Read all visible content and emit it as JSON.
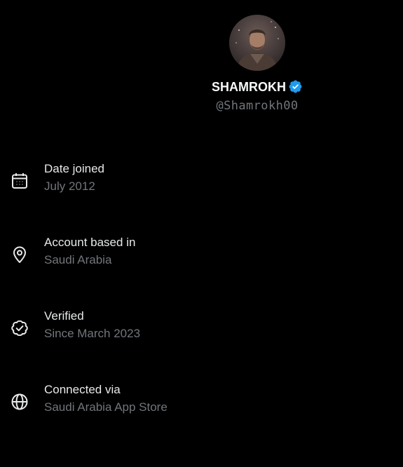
{
  "profile": {
    "display_name": "SHAMROKH",
    "handle": "@Shamrokh00",
    "avatar_icon": "profile-avatar",
    "verified_icon": "verified-badge-icon",
    "badge_color": "#1d9bf0"
  },
  "info_items": [
    {
      "icon": "calendar-icon",
      "label": "Date joined",
      "value": "July 2012"
    },
    {
      "icon": "location-pin-icon",
      "label": "Account based in",
      "value": "Saudi Arabia"
    },
    {
      "icon": "verified-check-icon",
      "label": "Verified",
      "value": "Since March 2023"
    },
    {
      "icon": "globe-icon",
      "label": "Connected via",
      "value": "Saudi Arabia App Store"
    }
  ],
  "colors": {
    "background": "#000000",
    "primary_text": "#e7e9ea",
    "secondary_text": "#71767b"
  }
}
